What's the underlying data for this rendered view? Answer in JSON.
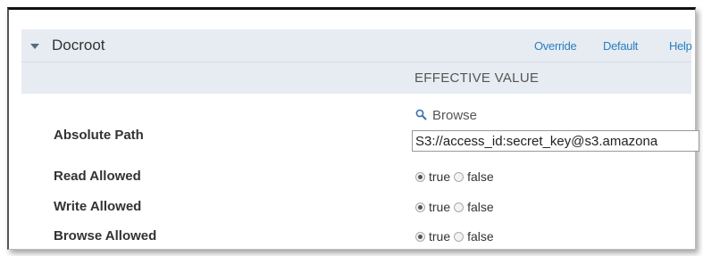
{
  "section": {
    "title": "Docroot",
    "links": {
      "override": "Override",
      "default": "Default",
      "help": "Help"
    },
    "column_header": "EFFECTIVE VALUE"
  },
  "fields": {
    "absolute_path": {
      "label": "Absolute Path",
      "browse_label": "Browse",
      "value": "S3://access_id:secret_key@s3.amazona"
    },
    "read_allowed": {
      "label": "Read Allowed",
      "selected": "true",
      "options": [
        "true",
        "false"
      ]
    },
    "write_allowed": {
      "label": "Write Allowed",
      "selected": "true",
      "options": [
        "true",
        "false"
      ]
    },
    "browse_allowed": {
      "label": "Browse Allowed",
      "selected": "true",
      "options": [
        "true",
        "false"
      ]
    }
  },
  "colors": {
    "header_bg": "#e6ecf2",
    "link": "#2a7fc0"
  },
  "icons": {
    "collapse": "triangle-down-icon",
    "browse": "magnifier-icon"
  }
}
